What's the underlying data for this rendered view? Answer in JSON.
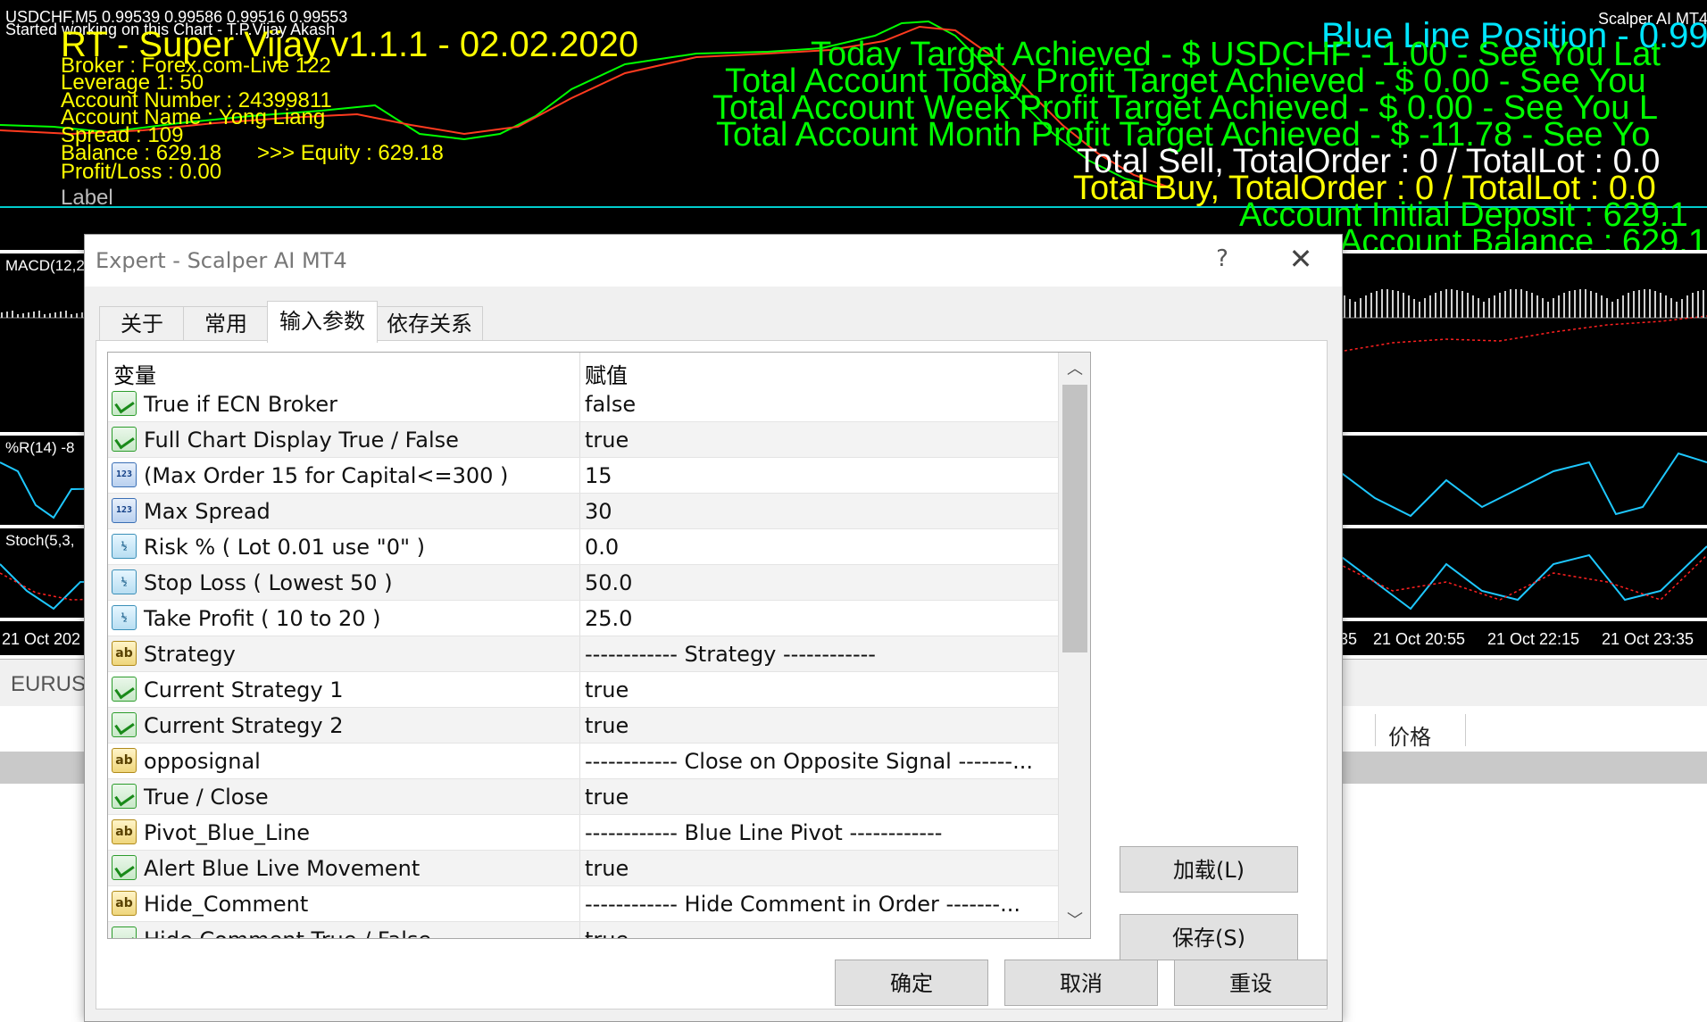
{
  "chart": {
    "symbol_line": "USDCHF,M5  0.99539 0.99586 0.99516 0.99553",
    "started_line": "Started working on this Chart - T.P.Vijay Akash",
    "ea_title": "RT - Super Vijay v1.1.1 - 02.02.2020",
    "broker": "Broker : Forex.com-Live 122",
    "leverage": "Leverage   1: 50",
    "account_number": "Account Number     : 24399811",
    "account_name": "Account Name      : Yong Liang",
    "spread": "Spread : 109",
    "balance": "Balance :  629.18",
    "equity": ">>> Equity : 629.18",
    "profit_loss": "Profit/Loss : 0.00",
    "label": "Label",
    "corner_label": "Scalper AI MT4",
    "blue_line": "Blue Line Position  - 0.99",
    "today_target": "Today Target Achieved - $ USDCHF - 1.00 - See You Lat",
    "total_today": "Total Account Today Profit Target Achieved - $ 0.00 - See You",
    "total_week": "Total Account Week Profit Target Achieved - $ 0.00 - See You L",
    "total_month": "Total Account Month Profit Target Achieved - $ -11.78 - See Yo",
    "total_sell": "Total Sell, TotalOrder : 0 / TotalLot : 0.0",
    "total_buy": "Total Buy, TotalOrder : 0 / TotalLot : 0.0",
    "initial_deposit": "Account Initial Deposit : 629.1",
    "account_balance": "Account Balance : 629.1",
    "macd_label": "MACD(12,2",
    "wpr_label": "%R(14) -8",
    "stoch_label": "Stoch(5,3,",
    "time_labels": [
      "21 Oct 202",
      "35",
      "21 Oct 20:55",
      "21 Oct 22:15",
      "21 Oct 23:35"
    ],
    "symbol_tab": "EURUS",
    "price_header": "价格"
  },
  "dialog": {
    "title": "Expert - Scalper AI MT4",
    "help": "?",
    "close": "✕",
    "tabs": [
      "关于",
      "常用",
      "输入参数",
      "依存关系"
    ],
    "active_tab": "输入参数",
    "columns": {
      "variable": "变量",
      "value": "赋值"
    },
    "params": [
      {
        "name": "True if ECN Broker",
        "value": "false",
        "type": "bool"
      },
      {
        "name": "Full Chart Display True / False",
        "value": "true",
        "type": "bool"
      },
      {
        "name": "(Max Order 15 for Capital<=300 )",
        "value": "15",
        "type": "int"
      },
      {
        "name": "Max Spread",
        "value": "30",
        "type": "int"
      },
      {
        "name": "Risk % ( Lot 0.01 use \"0\" )",
        "value": "0.0",
        "type": "double"
      },
      {
        "name": "Stop Loss ( Lowest 50 )",
        "value": "50.0",
        "type": "double"
      },
      {
        "name": "Take Profit ( 10 to 20 )",
        "value": "25.0",
        "type": "double"
      },
      {
        "name": "Strategy",
        "value": "------------ Strategy ------------",
        "type": "string"
      },
      {
        "name": "Current Strategy 1",
        "value": "true",
        "type": "bool"
      },
      {
        "name": "Current Strategy 2",
        "value": "true",
        "type": "bool"
      },
      {
        "name": "opposignal",
        "value": "------------ Close on Opposite Signal -------...",
        "type": "string"
      },
      {
        "name": "True / Close",
        "value": "true",
        "type": "bool"
      },
      {
        "name": "Pivot_Blue_Line",
        "value": "------------ Blue Line Pivot ------------",
        "type": "string"
      },
      {
        "name": "Alert Blue Live Movement",
        "value": "true",
        "type": "bool"
      },
      {
        "name": "Hide_Comment",
        "value": "------------ Hide Comment in Order  -------...",
        "type": "string"
      },
      {
        "name": "Hide Comment True / False",
        "value": "true",
        "type": "bool"
      }
    ],
    "icons": {
      "bool": "check-icon",
      "int": "123",
      "double": "½",
      "string": "ab"
    },
    "buttons": {
      "load": "加载(L)",
      "save": "保存(S)",
      "ok": "确定",
      "cancel": "取消",
      "reset": "重设"
    }
  }
}
